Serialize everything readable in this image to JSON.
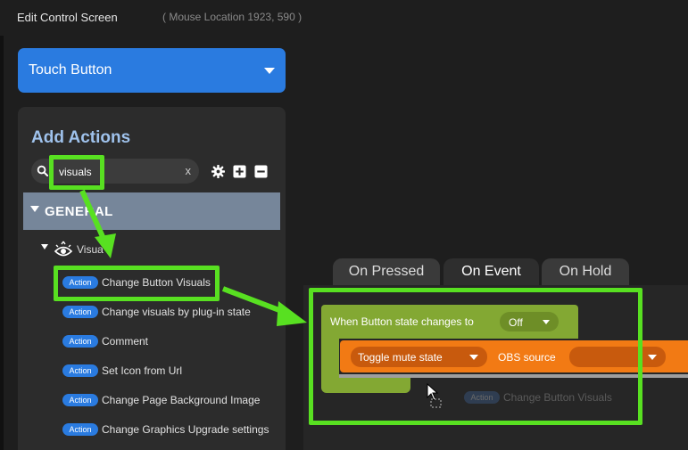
{
  "header": {
    "title": "Edit Control Screen",
    "mouse_location": "( Mouse Location 1923, 590 )"
  },
  "control_type": {
    "label": "Touch Button"
  },
  "actions_panel": {
    "heading": "Add Actions",
    "search": {
      "value": "visuals",
      "clear_label": "x"
    },
    "category": {
      "label": "GENERAL"
    },
    "subcategory": {
      "label": "Visua"
    },
    "badge_label": "Action",
    "items": [
      {
        "label": "Change Button Visuals"
      },
      {
        "label": "Change visuals by plug-in state"
      },
      {
        "label": "Comment"
      },
      {
        "label": "Set Icon from Url"
      },
      {
        "label": "Change Page Background Image"
      },
      {
        "label": "Change Graphics Upgrade settings"
      }
    ]
  },
  "tabs": [
    {
      "label": "On Pressed"
    },
    {
      "label": "On Event"
    },
    {
      "label": "On Hold"
    }
  ],
  "event_block": {
    "label": "When Button state changes to",
    "state_value": "Off"
  },
  "obs_block": {
    "action_value": "Toggle mute state",
    "source_label": "OBS source",
    "source_value": ""
  },
  "drag_ghost": {
    "badge": "Action",
    "label": "Change Button Visuals"
  },
  "colors": {
    "accent_blue": "#2a7be0",
    "event_green": "#83a833",
    "obs_orange": "#f27a14",
    "highlight": "#58e021",
    "category_bg": "#76869a"
  }
}
